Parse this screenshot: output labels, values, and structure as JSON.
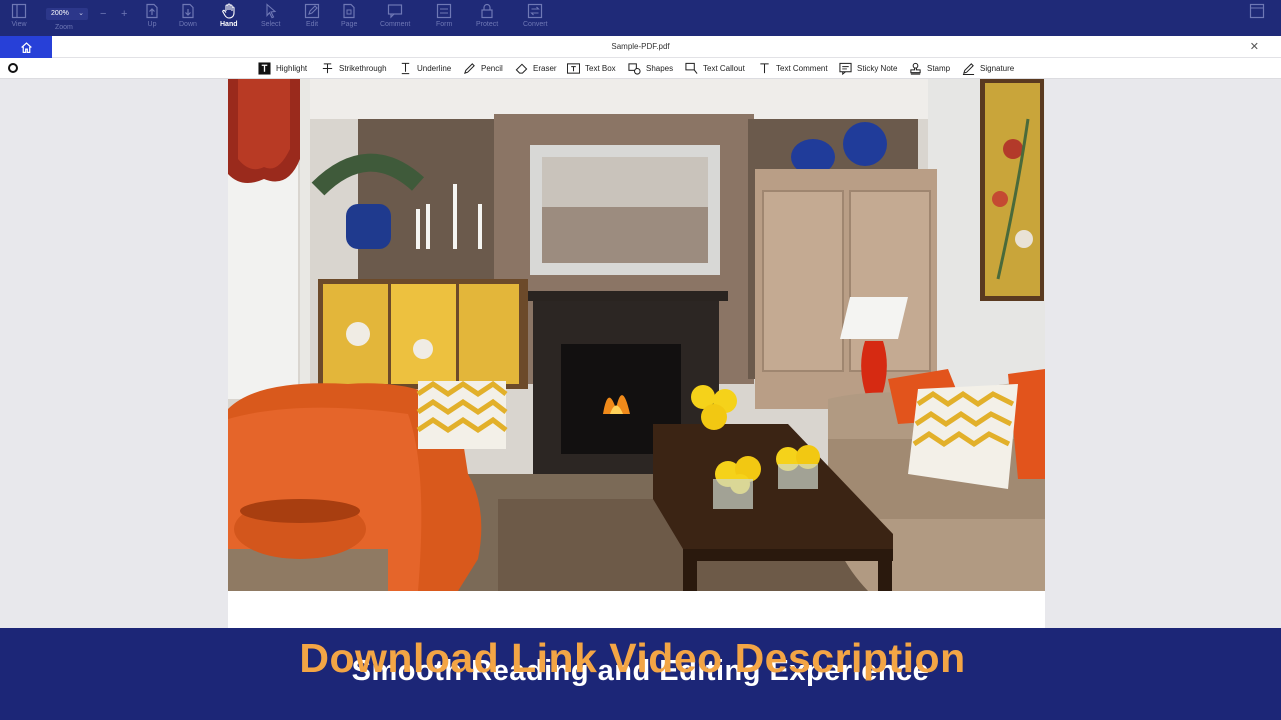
{
  "toolbar": {
    "view_label": "View",
    "zoom_value": "200%",
    "zoom_label": "Zoom",
    "zoom_minus": "−",
    "zoom_plus": "+",
    "up_label": "Up",
    "down_label": "Down",
    "hand_label": "Hand",
    "select_label": "Select",
    "edit_label": "Edit",
    "page_label": "Page",
    "comment_label": "Comment",
    "form_label": "Form",
    "protect_label": "Protect",
    "convert_label": "Convert"
  },
  "tabs": {
    "document_title": "Sample-PDF.pdf",
    "close_symbol": "✕"
  },
  "annotation_tools": [
    {
      "label": "Highlight",
      "icon": "highlight-icon"
    },
    {
      "label": "Strikethrough",
      "icon": "strikethrough-icon"
    },
    {
      "label": "Underline",
      "icon": "underline-icon"
    },
    {
      "label": "Pencil",
      "icon": "pencil-icon"
    },
    {
      "label": "Eraser",
      "icon": "eraser-icon"
    },
    {
      "label": "Text Box",
      "icon": "text-box-icon"
    },
    {
      "label": "Shapes",
      "icon": "shapes-icon"
    },
    {
      "label": "Text Callout",
      "icon": "text-callout-icon"
    },
    {
      "label": "Text Comment",
      "icon": "text-comment-icon"
    },
    {
      "label": "Sticky Note",
      "icon": "sticky-note-icon"
    },
    {
      "label": "Stamp",
      "icon": "stamp-icon"
    },
    {
      "label": "Signature",
      "icon": "signature-icon"
    }
  ],
  "overlay": {
    "subtitle": "Smooth Reading and Editing Experience",
    "promo": "Download Link Video Description"
  },
  "colors": {
    "toolbar_bg": "#1f2a78",
    "accent_blue": "#2740d8",
    "banner_bg": "#1c2677",
    "promo_orange": "#f3a545"
  }
}
